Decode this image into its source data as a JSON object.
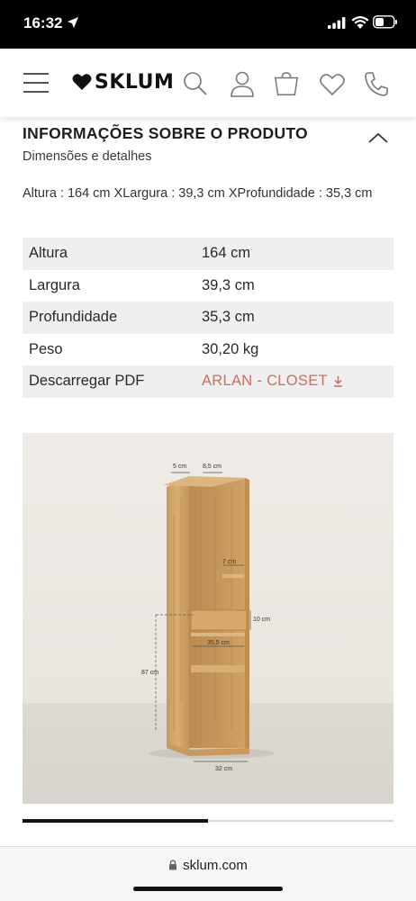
{
  "status_bar": {
    "time": "16:32"
  },
  "header": {
    "logo_text": "SKLUM",
    "icons": [
      "menu-icon",
      "heart-logo-icon",
      "search-icon",
      "user-icon",
      "cart-icon",
      "wishlist-icon",
      "phone-icon"
    ]
  },
  "product_info": {
    "title": "INFORMAÇÕES SOBRE O PRODUTO",
    "subtitle": "Dimensões e detalhes",
    "dimensions_line": "Altura : 164 cm XLargura : 39,3 cm XProfundidade : 35,3 cm",
    "specs": [
      {
        "label": "Altura",
        "value": "164 cm"
      },
      {
        "label": "Largura",
        "value": "39,3 cm"
      },
      {
        "label": "Profundidade",
        "value": "35,3 cm"
      },
      {
        "label": "Peso",
        "value": "30,20 kg"
      },
      {
        "label": "Descarregar PDF",
        "value": "ARLAN - CLOSET"
      }
    ],
    "link_color": "#c9705f"
  },
  "image_annotations": {
    "top_left": "5 cm",
    "top_right": "8,5 cm",
    "shelf_small": "7 cm",
    "drawer_height": "10 cm",
    "inner_width": "35,5 cm",
    "lower_height": "87 cm",
    "base_width": "32 cm"
  },
  "carousel": {
    "progress": 0.5
  },
  "browser": {
    "url": "sklum.com"
  }
}
